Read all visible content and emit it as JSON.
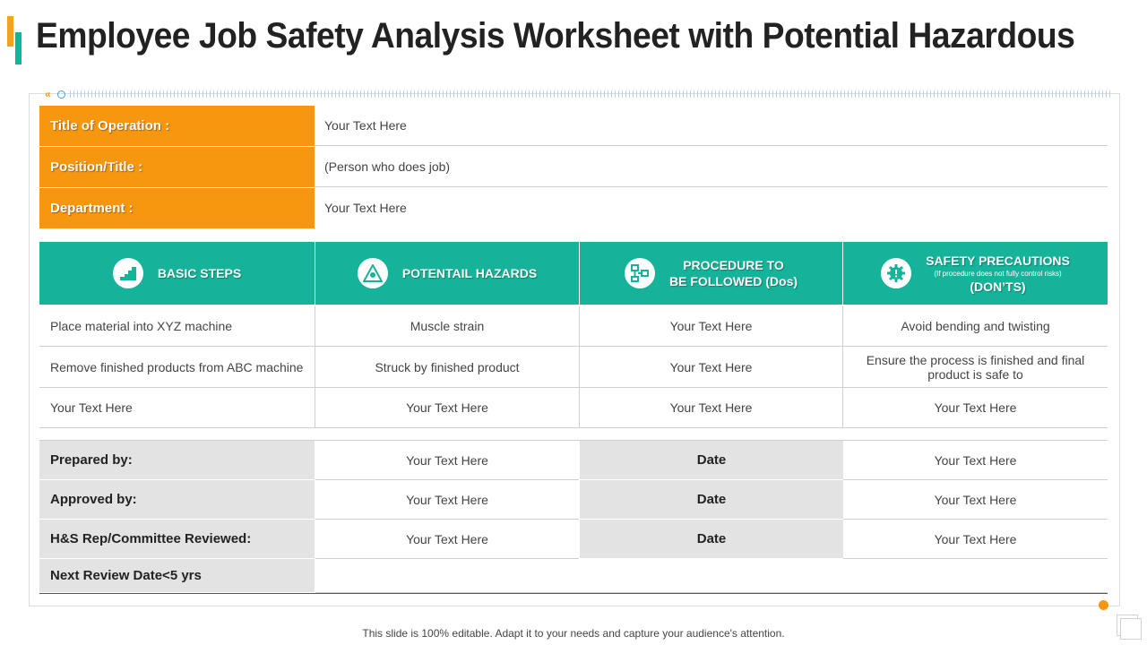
{
  "title": "Employee Job Safety Analysis Worksheet with Potential Hazardous",
  "info": [
    {
      "label": "Title of Operation :",
      "value": "Your Text Here"
    },
    {
      "label": "Position/Title :",
      "value": "(Person who does job)"
    },
    {
      "label": "Department :",
      "value": "Your Text Here"
    }
  ],
  "headers": {
    "basic_steps": "BASIC STEPS",
    "hazards": "POTENTAIL HAZARDS",
    "procedure_line1": "PROCEDURE TO",
    "procedure_line2": "BE FOLLOWED (Dos)",
    "safety_line1": "SAFETY PRECAUTIONS",
    "safety_sub": "(If procedure does not fully control risks)",
    "safety_line3": "(DON’TS)"
  },
  "icons": {
    "basic_steps": "stairs-icon",
    "hazards": "warning-triangle-icon",
    "procedure": "flowchart-icon",
    "safety": "gear-alert-icon"
  },
  "rows": [
    [
      "Place material into XYZ machine",
      "Muscle strain",
      "Your Text Here",
      "Avoid bending and twisting"
    ],
    [
      "Remove finished products from ABC machine",
      "Struck by finished product",
      "Your Text Here",
      "Ensure the process is finished and final product is safe to"
    ],
    [
      "Your Text Here",
      "Your Text Here",
      "Your Text Here",
      "Your Text Here"
    ]
  ],
  "signoff": [
    {
      "label": "Prepared by:",
      "value": "Your Text Here",
      "date_label": "Date",
      "date_value": "Your Text Here"
    },
    {
      "label": "Approved by:",
      "value": "Your Text Here",
      "date_label": "Date",
      "date_value": "Your Text Here"
    },
    {
      "label": "H&S Rep/Committee Reviewed:",
      "value": "Your Text Here",
      "date_label": "Date",
      "date_value": "Your Text Here"
    }
  ],
  "next_review": {
    "label": "Next Review Date<5 yrs",
    "value": ""
  },
  "footer": "This slide is 100% editable. Adapt it to your needs and capture your audience's attention.",
  "colors": {
    "orange": "#f7960f",
    "teal": "#15b39a",
    "gray": "#e3e3e3"
  }
}
